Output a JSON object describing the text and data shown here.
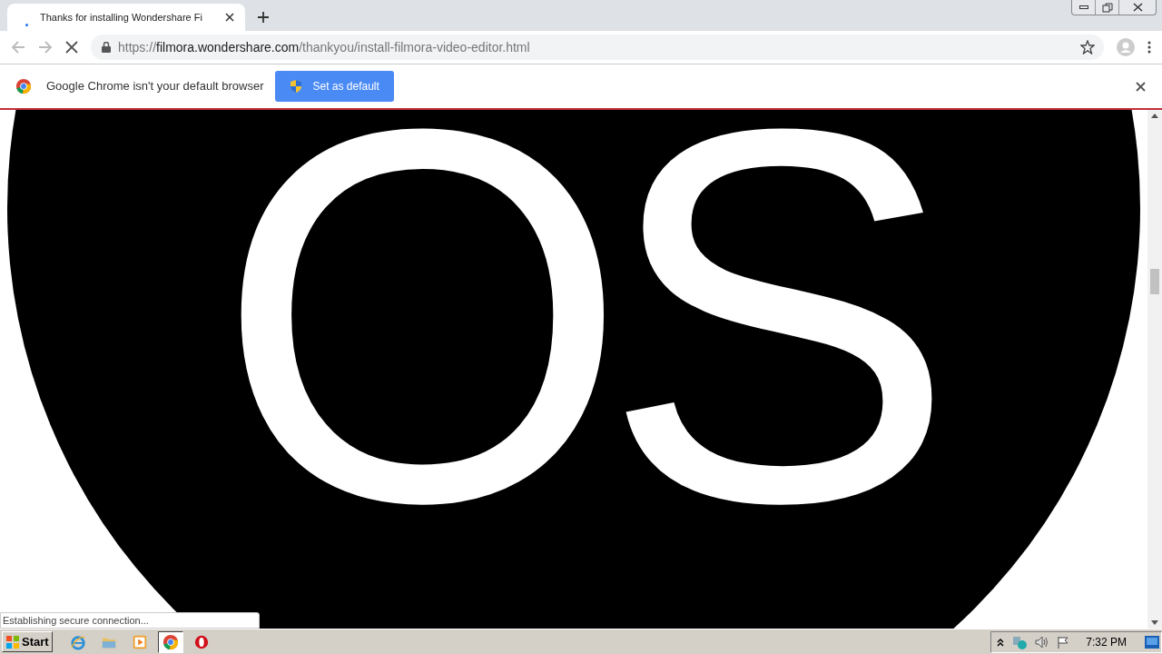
{
  "tabs": [
    {
      "title": "Thanks for installing Wondershare Fi",
      "selected": true,
      "loading": true
    }
  ],
  "address": {
    "scheme": "https://",
    "host": "filmora.wondershare.com",
    "path": "/thankyou/install-filmora-video-editor.html",
    "loading": true
  },
  "infobar": {
    "message": "Google Chrome isn't your default browser",
    "button": "Set as default"
  },
  "page": {
    "logo_text": "OS"
  },
  "status_bubble": "Establishing secure connection...",
  "taskbar": {
    "start": "Start",
    "apps": [
      {
        "kind": "ie",
        "selected": false
      },
      {
        "kind": "explorer",
        "selected": false
      },
      {
        "kind": "media",
        "selected": false
      },
      {
        "kind": "chrome",
        "selected": true
      },
      {
        "kind": "opera",
        "selected": false
      }
    ],
    "clock": "7:32 PM"
  }
}
